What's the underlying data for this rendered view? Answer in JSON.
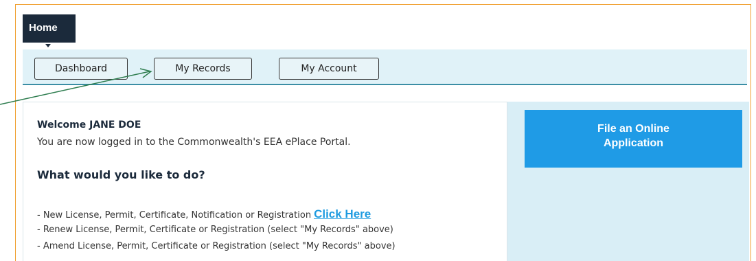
{
  "nav": {
    "home_label": "Home",
    "tabs": [
      {
        "label": "Dashboard"
      },
      {
        "label": "My Records"
      },
      {
        "label": "My Account"
      }
    ]
  },
  "main": {
    "welcome": "Welcome JANE DOE",
    "logged_in_text": "You are now logged in to the Commonwealth's EEA ePlace Portal.",
    "question": "What would you like to do?",
    "actions": [
      {
        "text": "- New License, Permit, Certificate, Notification or Registration",
        "link": "Click Here"
      },
      {
        "text": "- Renew License, Permit, Certificate or Registration (select \"My Records\" above)"
      },
      {
        "text": "- Amend License, Permit, Certificate or Registration (select \"My Records\" above)"
      }
    ]
  },
  "sidebar": {
    "file_button_line1": "File an Online",
    "file_button_line2": "Application"
  },
  "colors": {
    "frame": "#f0a030",
    "home_tab": "#1b2a3b",
    "navbar_bg": "#e0f2f8",
    "navbar_border": "#3b8ea5",
    "link": "#1e9be0",
    "file_button": "#1f9be6",
    "sidebar_bg": "#d9eef6",
    "annotation_arrow": "#2e7d4f"
  }
}
